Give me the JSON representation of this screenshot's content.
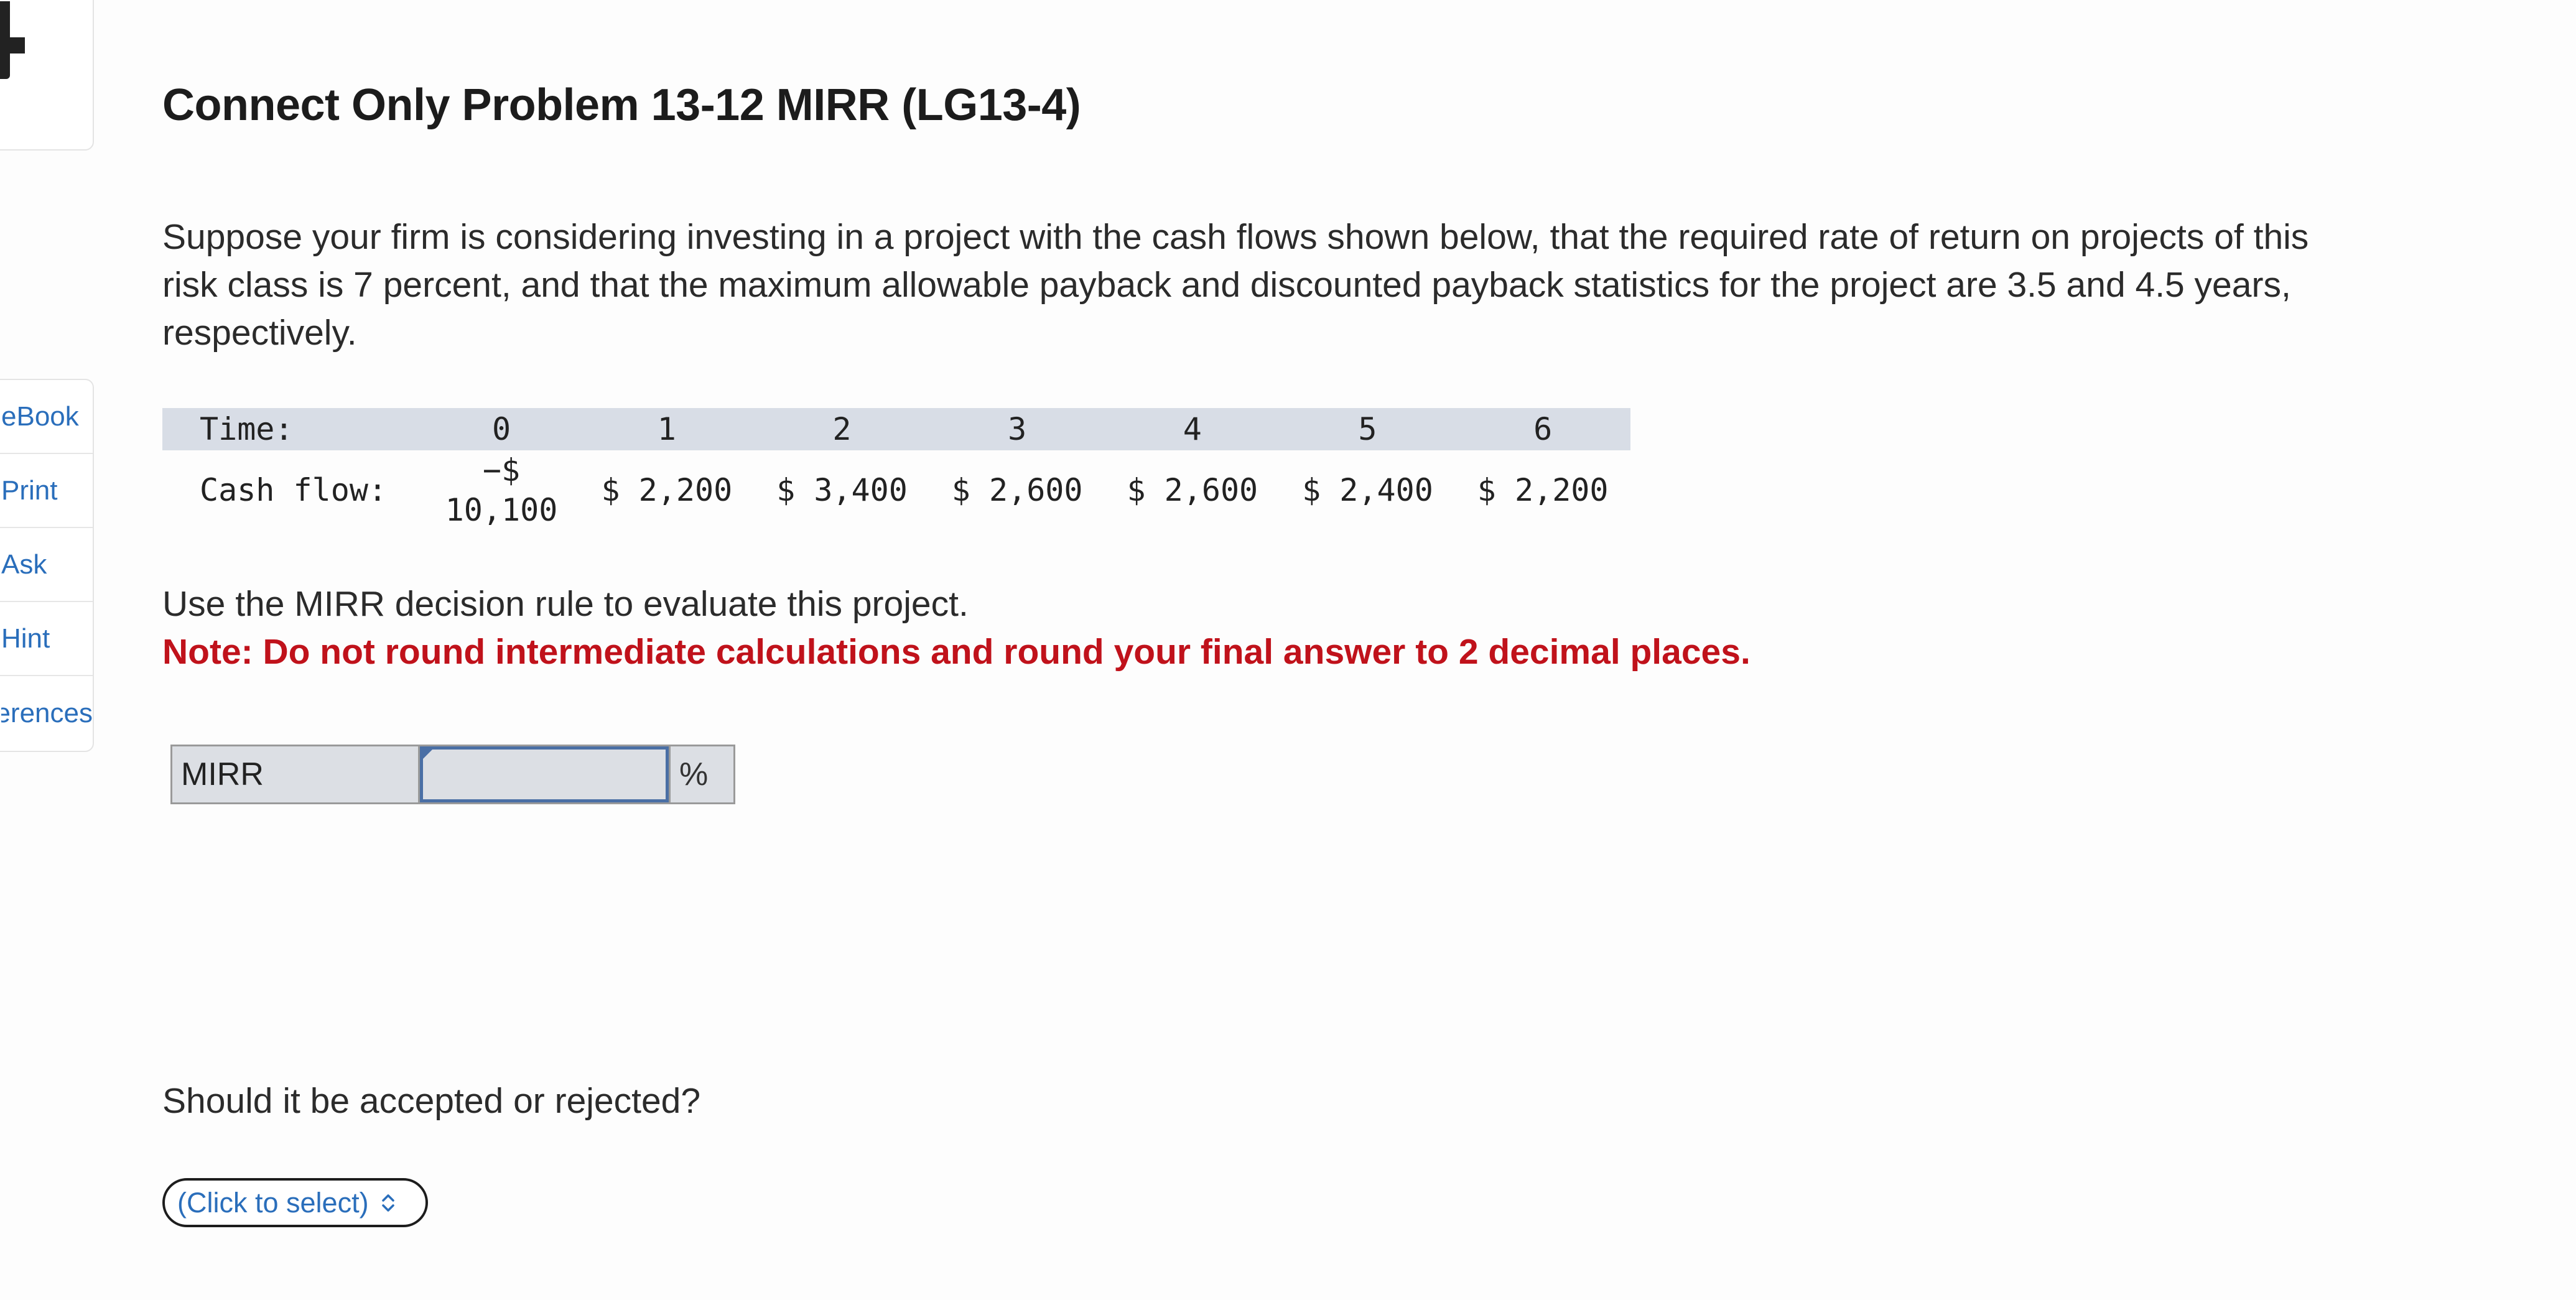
{
  "sidebar": {
    "items": [
      {
        "label": "eBook"
      },
      {
        "label": "Print"
      },
      {
        "label": "Ask"
      },
      {
        "label": "Hint"
      },
      {
        "label": "References"
      }
    ]
  },
  "title": "Connect Only Problem 13-12 MIRR (LG13-4)",
  "problem_text": "Suppose your firm is considering investing in a project with the cash flows shown below, that the required rate of return on projects of this risk class is 7 percent, and that the maximum allowable payback and discounted payback statistics for the project are 3.5 and 4.5 years, respectively.",
  "cash_flow_table": {
    "header_label": "Time:",
    "periods": [
      "0",
      "1",
      "2",
      "3",
      "4",
      "5",
      "6"
    ],
    "row_label": "Cash flow:",
    "flow0_line1": "−$",
    "flow0_line2": "10,100",
    "flows": [
      "$ 2,200",
      "$ 3,400",
      "$ 2,600",
      "$ 2,600",
      "$ 2,400",
      "$ 2,200"
    ]
  },
  "instruction": "Use the MIRR decision rule to evaluate this project.",
  "note": "Note: Do not round intermediate calculations and round your final answer to 2 decimal places.",
  "mirr": {
    "label": "MIRR",
    "value": "",
    "unit": "%"
  },
  "question": "Should it be accepted or rejected?",
  "decision_select": {
    "label": "(Click to select)"
  },
  "colors": {
    "note_red": "#c0121b",
    "link_blue": "#2a6ebb",
    "table_header_bg": "#d8dde6"
  }
}
